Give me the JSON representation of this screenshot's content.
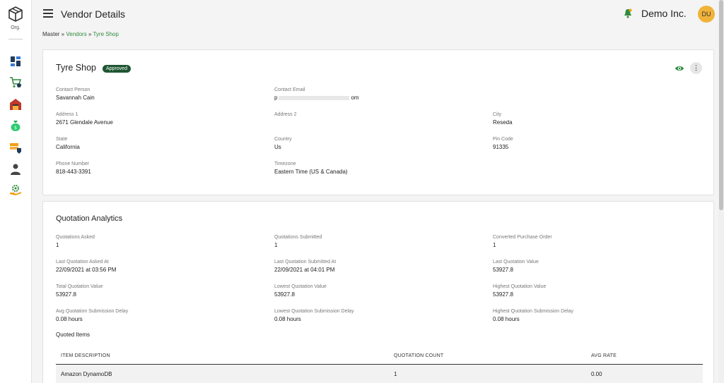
{
  "app": {
    "org_label": "Org.",
    "page_title": "Vendor Details",
    "company_name": "Demo Inc.",
    "avatar_initials": "DU",
    "accent_color": "#2e8b3d",
    "avatar_color": "#f0b33a"
  },
  "sidebar": {
    "icons": [
      "dashboard-icon",
      "cart-icon",
      "warehouse-icon",
      "money-bag-icon",
      "invoice-icon",
      "user-icon",
      "settings-icon"
    ]
  },
  "breadcrumb": {
    "root": "Master",
    "sep1": " » ",
    "vendors": "Vendors",
    "sep2": " » ",
    "current": "Tyre Shop"
  },
  "vendor": {
    "name": "Tyre Shop",
    "status": "Approved",
    "fields": {
      "contact_person": {
        "label": "Contact Person",
        "value": "Savannah Cain"
      },
      "contact_email": {
        "label": "Contact Email",
        "value_start": "p",
        "value_end": "om"
      },
      "address1": {
        "label": "Address 1",
        "value": "2671 Glendale Avenue"
      },
      "address2": {
        "label": "Address 2",
        "value": ""
      },
      "city": {
        "label": "City",
        "value": "Reseda"
      },
      "state": {
        "label": "State",
        "value": "California"
      },
      "country": {
        "label": "Country",
        "value": "Us"
      },
      "pin_code": {
        "label": "Pin Code",
        "value": "91335"
      },
      "phone": {
        "label": "Phone Number",
        "value": "818-443-3391"
      },
      "timezone": {
        "label": "Timezone",
        "value": "Eastern Time (US & Canada)"
      }
    }
  },
  "analytics": {
    "title": "Quotation Analytics",
    "fields": {
      "asked": {
        "label": "Quotations Asked",
        "value": "1"
      },
      "submitted": {
        "label": "Quotations Submitted",
        "value": "1"
      },
      "converted": {
        "label": "Converted Purchase Order",
        "value": "1"
      },
      "last_asked": {
        "label": "Last Quotation Asked At",
        "value": "22/09/2021 at 03:56 PM"
      },
      "last_submitted": {
        "label": "Last Quotation Submitted At",
        "value": "22/09/2021 at 04:01 PM"
      },
      "last_value": {
        "label": "Last Quotation Value",
        "value": "53927.8"
      },
      "total_value": {
        "label": "Total Quotation Value",
        "value": "53927.8"
      },
      "lowest_value": {
        "label": "Lowest Quotation Value",
        "value": "53927.8"
      },
      "highest_value": {
        "label": "Highest Quotation Value",
        "value": "53927.8"
      },
      "avg_delay": {
        "label": "Avg Quotation Submission Delay",
        "value": "0.08 hours"
      },
      "lowest_delay": {
        "label": "Lowest Quotation Submission Delay",
        "value": "0.08 hours"
      },
      "highest_delay": {
        "label": "Highest Quotation Submission Delay",
        "value": "0.08 hours"
      }
    },
    "quoted_items_heading": "Quoted Items",
    "table": {
      "columns": [
        "ITEM DESCRIPTION",
        "QUOTATION COUNT",
        "AVG RATE"
      ],
      "rows": [
        {
          "description": "Amazon DynamoDB",
          "count": "1",
          "avg_rate": "0.00"
        }
      ]
    }
  }
}
